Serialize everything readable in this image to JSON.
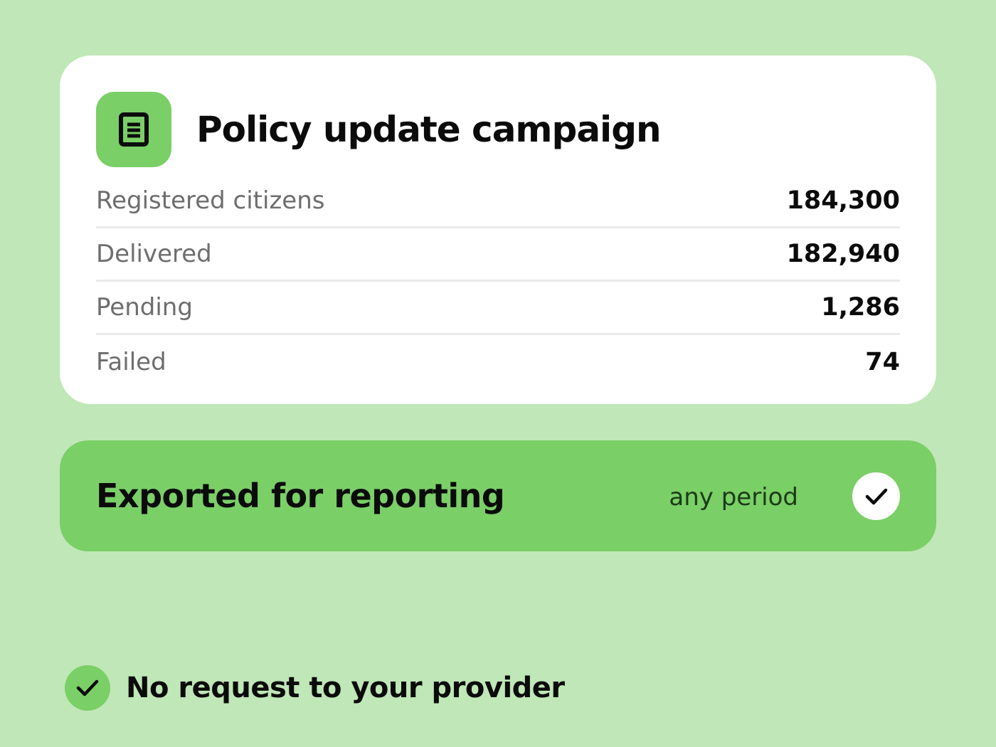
{
  "colors": {
    "background": "#c0e7b7",
    "accent": "#7acf67",
    "card": "#ffffff",
    "text_dark": "#0b0b0b",
    "text_muted": "#6d6d6d"
  },
  "campaign": {
    "icon": "document-icon",
    "title": "Policy update campaign",
    "stats": [
      {
        "label": "Registered citizens",
        "value": "184,300"
      },
      {
        "label": "Delivered",
        "value": "182,940"
      },
      {
        "label": "Pending",
        "value": "1,286"
      },
      {
        "label": "Failed",
        "value": "74"
      }
    ]
  },
  "export": {
    "title": "Exported for reporting",
    "period": "any period",
    "icon": "checkmark-icon",
    "checked": true
  },
  "note": {
    "icon": "checkmark-icon",
    "text": "No request to your provider"
  }
}
